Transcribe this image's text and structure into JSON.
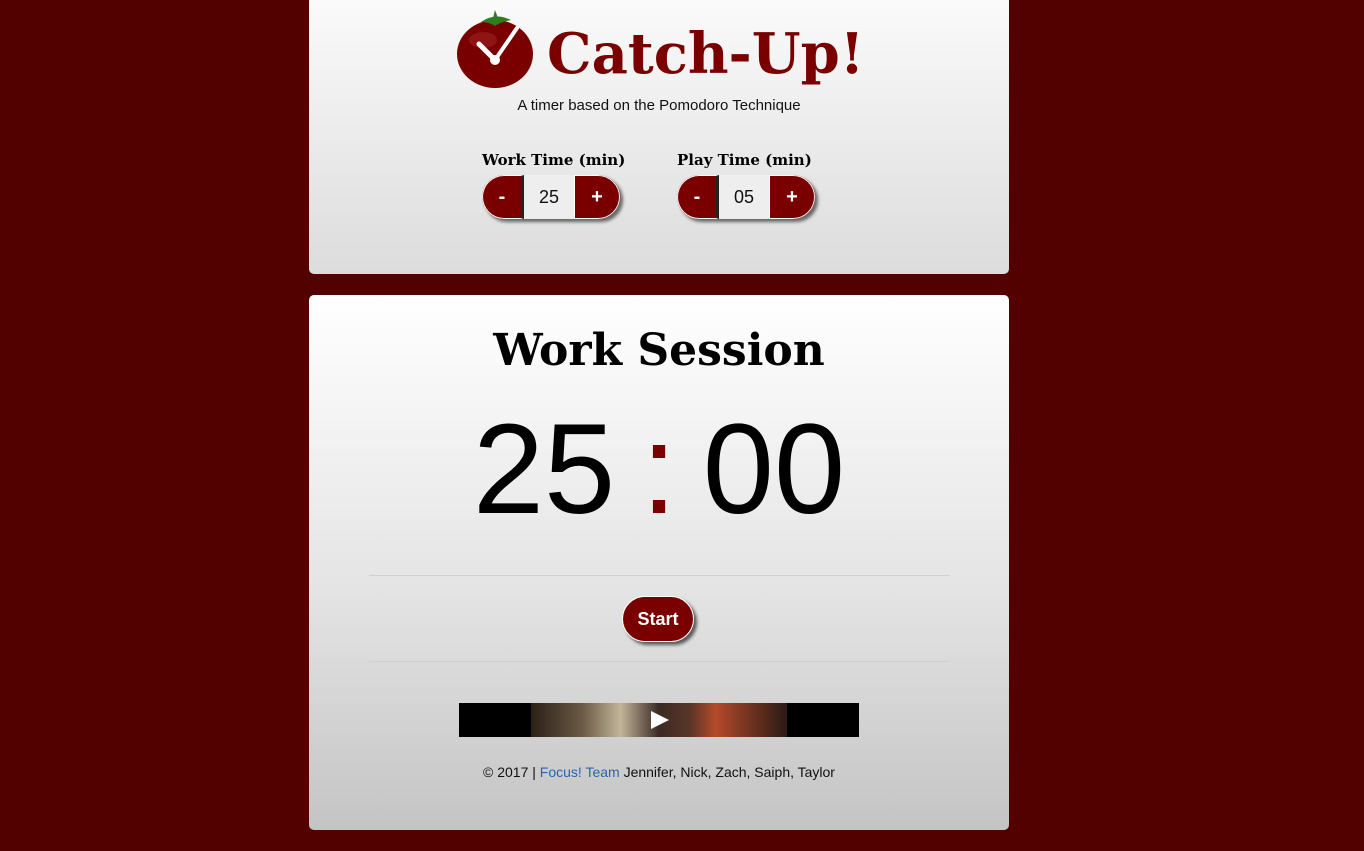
{
  "header": {
    "title": "Catch-Up!",
    "tagline": "A timer based on the Pomodoro Technique"
  },
  "settings": {
    "work": {
      "label": "Work Time (min)",
      "minus": "-",
      "value": "25",
      "plus": "+"
    },
    "play": {
      "label": "Play Time (min)",
      "minus": "-",
      "value": "05",
      "plus": "+"
    }
  },
  "session": {
    "title": "Work Session",
    "minutes": "25",
    "separator": ":",
    "seconds": "00",
    "start_label": "Start"
  },
  "video": {
    "icon": "play-icon"
  },
  "footer": {
    "copyright": "© 2017 |",
    "team_link": "Focus! Team",
    "members": "Jennifer, Nick, Zach, Saiph, Taylor"
  },
  "colors": {
    "background": "#530000",
    "accent": "#7a0000",
    "link": "#2a64b0"
  }
}
